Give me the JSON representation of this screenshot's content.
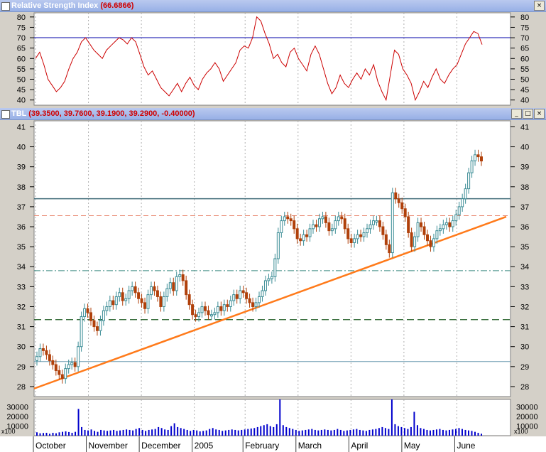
{
  "rsi_panel": {
    "title": "Relative Strength Index",
    "value": "(66.6866)",
    "yticks": [
      80,
      75,
      70,
      65,
      60,
      55,
      50,
      45,
      40
    ],
    "ylim": [
      37.5,
      82
    ],
    "reference_line": 70
  },
  "price_panel": {
    "title": "TBL",
    "values": "(39.3500, 39.7600, 39.1900, 39.2900, -0.40000)",
    "yticks": [
      41,
      40,
      39,
      38,
      37,
      36,
      35,
      34,
      33,
      32,
      31,
      30,
      29,
      28
    ],
    "ylim": [
      27.5,
      41.3
    ]
  },
  "volume_panel": {
    "yticks": [
      "30000",
      "20000",
      "10000"
    ],
    "multiplier": "x100",
    "ylim": [
      0,
      38000
    ]
  },
  "months": [
    "October",
    "November",
    "December",
    "2005",
    "February",
    "March",
    "April",
    "May",
    "June"
  ],
  "window_buttons": {
    "minimize": "_",
    "restore": "□",
    "close": "×"
  },
  "colors": {
    "up_candle": "#3a8c95",
    "down_candle": "#b0400a",
    "rsi_line": "#cc0000",
    "trendline": "#ff7a1a",
    "resistance": "#3f6b78",
    "volume": "#0000cc",
    "titlebar": "#98b0e6"
  },
  "chart_data": {
    "type": "candlestick",
    "symbol": "TBL",
    "ohlc_last": {
      "open": 39.35,
      "high": 39.76,
      "low": 39.19,
      "close": 39.29,
      "change": -0.4
    },
    "x_months": [
      "October",
      "November",
      "December",
      "2005",
      "February",
      "March",
      "April",
      "May",
      "June"
    ],
    "closes": [
      29.5,
      29.9,
      29.8,
      29.6,
      29.3,
      29.1,
      28.8,
      28.6,
      28.4,
      28.9,
      29.1,
      29.2,
      29.0,
      30.0,
      31.5,
      31.9,
      31.7,
      31.3,
      31.0,
      30.8,
      31.3,
      31.8,
      32.0,
      32.3,
      32.1,
      32.5,
      32.7,
      32.3,
      32.4,
      32.8,
      33.0,
      32.7,
      32.4,
      32.2,
      31.9,
      32.6,
      33.0,
      32.8,
      32.5,
      32.0,
      32.5,
      32.9,
      33.2,
      32.8,
      33.5,
      33.6,
      33.3,
      32.6,
      32.1,
      31.6,
      31.5,
      31.7,
      32.0,
      31.8,
      31.6,
      31.6,
      31.7,
      32.0,
      31.8,
      32.1,
      32.0,
      32.3,
      32.6,
      32.4,
      32.8,
      32.7,
      32.4,
      32.2,
      32.0,
      32.2,
      32.5,
      32.8,
      33.3,
      33.4,
      33.5,
      34.4,
      35.7,
      36.3,
      36.5,
      36.4,
      36.3,
      35.9,
      35.4,
      35.3,
      35.6,
      35.5,
      35.9,
      36.1,
      36.0,
      36.4,
      36.5,
      36.2,
      35.8,
      35.9,
      36.3,
      36.5,
      36.4,
      35.9,
      35.4,
      35.2,
      35.4,
      35.6,
      35.5,
      35.7,
      35.9,
      36.1,
      36.3,
      36.3,
      36.0,
      35.6,
      35.1,
      34.7,
      37.7,
      37.4,
      37.2,
      36.9,
      36.5,
      35.7,
      35.0,
      35.5,
      36.2,
      36.0,
      35.6,
      35.3,
      35.0,
      35.4,
      35.8,
      35.9,
      36.1,
      36.2,
      36.0,
      36.3,
      36.6,
      37.0,
      37.4,
      37.9,
      38.7,
      39.3,
      39.6,
      39.5,
      39.29
    ],
    "volume_series_x100": [
      3500,
      2500,
      2800,
      3000,
      2000,
      3000,
      2500,
      3500,
      4000,
      4500,
      3800,
      3000,
      4000,
      28000,
      9000,
      6000,
      5500,
      6500,
      5000,
      4000,
      6000,
      5500,
      5000,
      5500,
      6000,
      5000,
      5500,
      6000,
      6500,
      6000,
      5500,
      7000,
      8000,
      6000,
      5000,
      6000,
      6500,
      7000,
      9000,
      8000,
      6500,
      6000,
      10000,
      13000,
      9000,
      8000,
      7000,
      6000,
      5000,
      6000,
      5500,
      4500,
      5000,
      5500,
      7000,
      8000,
      6500,
      6000,
      5000,
      5500,
      6000,
      6500,
      6000,
      5500,
      6000,
      6500,
      7000,
      7500,
      8000,
      9000,
      10000,
      11000,
      12000,
      10000,
      9000,
      12000,
      38000,
      11000,
      9000,
      8000,
      7000,
      6000,
      5000,
      5500,
      6000,
      6500,
      7000,
      6000,
      5500,
      6000,
      6500,
      6000,
      5500,
      6000,
      7000,
      6000,
      5000,
      5500,
      6000,
      6500,
      7000,
      6000,
      5500,
      5000,
      6000,
      6500,
      7000,
      8000,
      9000,
      8000,
      7000,
      38000,
      12000,
      10000,
      9000,
      8000,
      7000,
      9000,
      25000,
      11000,
      8000,
      7000,
      6000,
      5500,
      6000,
      6500,
      7000,
      6000,
      5500,
      6000,
      6500,
      7000,
      8000,
      7000,
      6000,
      5500,
      5000,
      4000,
      3000,
      2000
    ],
    "rsi_series": [
      60,
      63,
      57,
      50,
      47,
      44,
      46,
      49,
      55,
      60,
      63,
      68,
      70,
      67,
      64,
      62,
      60,
      64,
      66,
      68,
      70,
      69,
      67,
      70,
      68,
      62,
      56,
      52,
      54,
      50,
      46,
      44,
      42,
      45,
      48,
      44,
      48,
      51,
      47,
      45,
      50,
      53,
      55,
      58,
      55,
      49,
      52,
      55,
      58,
      64,
      66,
      65,
      70,
      80,
      78,
      72,
      67,
      60,
      62,
      58,
      56,
      63,
      65,
      60,
      57,
      54,
      62,
      66,
      62,
      55,
      48,
      43,
      46,
      52,
      48,
      46,
      50,
      53,
      50,
      55,
      52,
      57,
      49,
      44,
      40,
      52,
      64,
      62,
      55,
      52,
      48,
      40,
      44,
      49,
      46,
      51,
      55,
      50,
      48,
      52,
      55,
      57,
      62,
      67,
      70,
      73,
      72,
      66.69
    ],
    "horizontal_lines": [
      37.4,
      36.55,
      33.8,
      31.35,
      29.25
    ],
    "trendline": {
      "start": 27.9,
      "end": 36.5
    },
    "rsi_reference": 70,
    "rsi_ylim": [
      37.5,
      82
    ],
    "price_ylim": [
      27.5,
      41.3
    ]
  }
}
